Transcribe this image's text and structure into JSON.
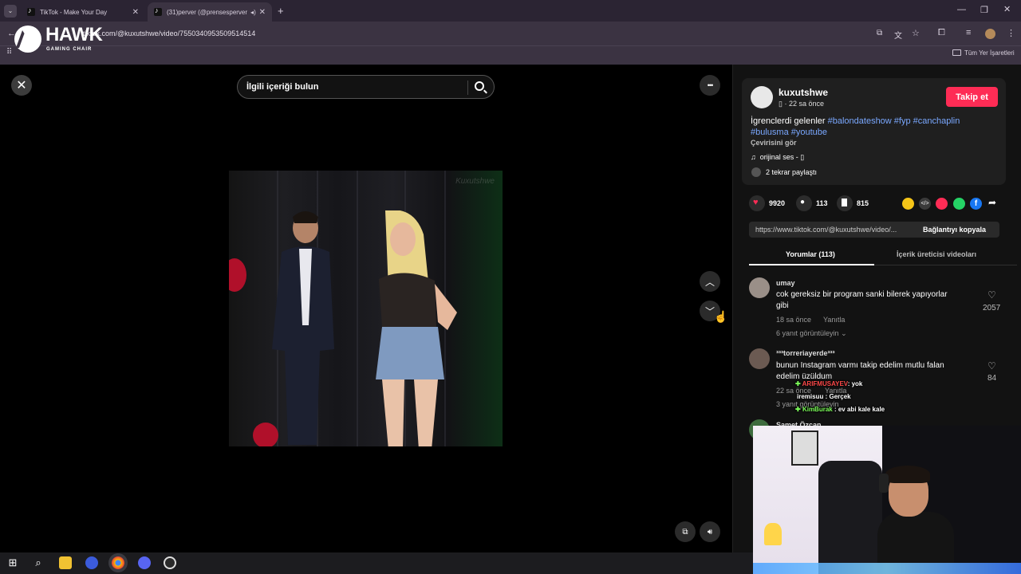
{
  "browser": {
    "tabs": [
      {
        "title": "TikTok - Make Your Day",
        "close": "✕"
      },
      {
        "title": "(31)perver (@prensesperver",
        "close": "✕"
      }
    ],
    "new_tab": "+",
    "url": "tiktok.com/@kuxutshwe/video/7550340953509514514",
    "bookmarks_label": "Tüm Yer İşaretleri"
  },
  "overlay_logo": {
    "brand": "HAWK",
    "tagline": "GAMING CHAIR"
  },
  "viewer": {
    "close_glyph": "✕",
    "search_placeholder": "İlgili içeriği bulun",
    "more_glyph": "•••",
    "watermark": "Kuxutshwe",
    "nav_up": "︿",
    "nav_down": "﹀"
  },
  "post": {
    "username": "kuxutshwe",
    "meta": "· 22 sa önce",
    "follow_label": "Takip et",
    "caption_text": "İgrenclerdi gelenler",
    "tags_line1": "#balondateshow #fyp #canchaplin",
    "tags_line2": "#bulusma #youtube",
    "translate": "Çevirisini gör",
    "sound": "orijinal ses - ",
    "shared": "2 tekrar paylaştı",
    "likes": "9920",
    "comments": "113",
    "saves": "815",
    "link": "https://www.tiktok.com/@kuxutshwe/video/...",
    "copy_link": "Bağlantıyı kopyala"
  },
  "panel_tabs": {
    "comments": "Yorumlar (113)",
    "creator_videos": "İçerik üreticisi videoları"
  },
  "comments": [
    {
      "user": "umay",
      "text_line1": "cok gereksiz bir program sanki bilerek yapıyorlar",
      "text_line2": "gibi",
      "time": "18 sa önce",
      "reply": "Yanıtla",
      "view_replies": "6 yanıt görüntüleyin",
      "likes": "2057"
    },
    {
      "user": "³³³torreriayerde³³³",
      "text_line1": "bunun Instagram varmı takip edelim mutlu falan",
      "text_line2": "edelim üzüldum",
      "time": "22 sa önce",
      "reply": "Yanıtla",
      "view_replies": "3 yanıt görüntüleyin",
      "likes": "84"
    },
    {
      "user": "Samet Özcan"
    }
  ],
  "chat": [
    {
      "user": "ARIFMUSAYEV",
      "text": ": yok",
      "color": "#ff4a4a"
    },
    {
      "user": "iremisuu",
      "text": ": Gerçek",
      "color": "#ffffff"
    },
    {
      "user": "KimBurak",
      "text": ": ev abi kale kale",
      "color": "#7dff5a"
    }
  ],
  "colors": {
    "accent": "#fe2c55",
    "hashtag": "#7aa8ff",
    "panel_bg": "#121212"
  }
}
